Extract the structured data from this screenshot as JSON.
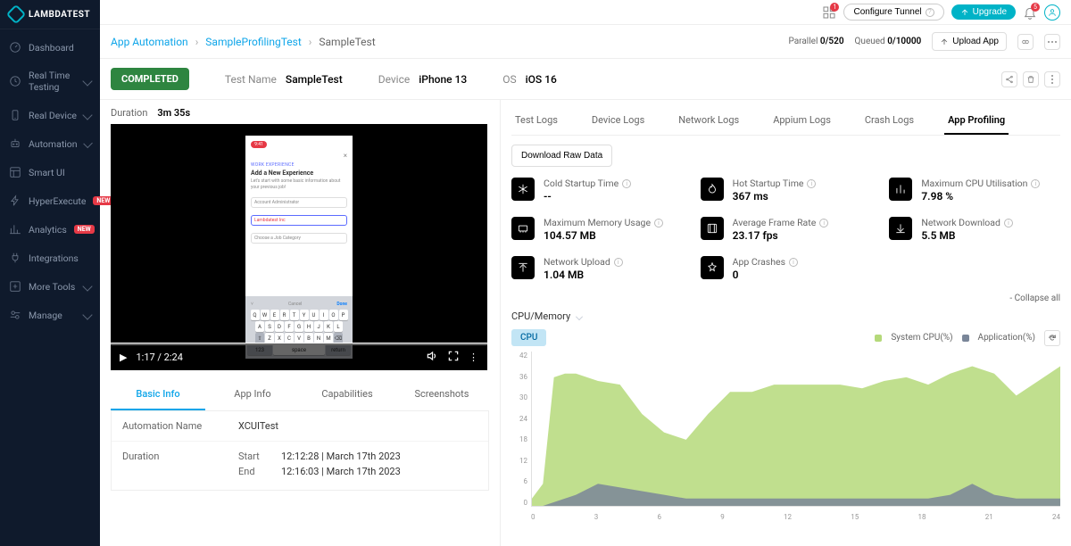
{
  "brand": "LAMBDATEST",
  "sidebar": [
    {
      "label": "Dashboard",
      "icon": "gauge"
    },
    {
      "label": "Real Time Testing",
      "icon": "clock",
      "chev": true
    },
    {
      "label": "Real Device",
      "icon": "device",
      "chev": true
    },
    {
      "label": "Automation",
      "icon": "robot",
      "chev": true
    },
    {
      "label": "Smart UI",
      "icon": "layout"
    },
    {
      "label": "HyperExecute",
      "icon": "bolt",
      "badge": "NEW"
    },
    {
      "label": "Analytics",
      "icon": "chart",
      "badge": "NEW"
    },
    {
      "label": "Integrations",
      "icon": "plug"
    },
    {
      "label": "More Tools",
      "icon": "plus",
      "chev": true
    },
    {
      "label": "Manage",
      "icon": "cog",
      "chev": true
    }
  ],
  "top": {
    "configure": "Configure Tunnel",
    "upgrade": "Upgrade",
    "notif_count": "5",
    "grid_count": "1"
  },
  "breadcrumbs": {
    "a": "App Automation",
    "b": "SampleProfilingTest",
    "c": "SampleTest"
  },
  "stats": {
    "parallel_label": "Parallel",
    "parallel_val": "0/520",
    "queued_label": "Queued",
    "queued_val": "0/10000",
    "upload": "Upload App"
  },
  "summary": {
    "status": "COMPLETED",
    "test_name_label": "Test Name",
    "test_name": "SampleTest",
    "device_label": "Device",
    "device": "iPhone 13",
    "os_label": "OS",
    "os": "iOS 16"
  },
  "duration_label": "Duration",
  "duration": "3m 35s",
  "video": {
    "time": "1:17 / 2:24",
    "screen": {
      "pill": "9:41",
      "section": "WORK EXPERIENCE",
      "title": "Add a New Experience",
      "sub": "Let's start with some basic information about your previous job!",
      "f1": "Account Administrator",
      "f2": "Lambdatest Inc",
      "f3": "Choose a Job Category",
      "cancel": "Cancel",
      "done": "Done",
      "row1": [
        "Q",
        "W",
        "E",
        "R",
        "T",
        "Y",
        "U",
        "I",
        "O",
        "P"
      ],
      "row2": [
        "A",
        "S",
        "D",
        "F",
        "G",
        "H",
        "J",
        "K",
        "L"
      ],
      "row3": [
        "Z",
        "X",
        "C",
        "V",
        "B",
        "N",
        "M"
      ],
      "btn123": "123",
      "btnSpace": "space",
      "btnReturn": "return"
    }
  },
  "info_tabs": [
    "Basic Info",
    "App Info",
    "Capabilities",
    "Screenshots"
  ],
  "basic_info": {
    "automation_name_label": "Automation Name",
    "automation_name": "XCUITest",
    "duration_label": "Duration",
    "start_label": "Start",
    "start": "12:12:28 | March 17th 2023",
    "end_label": "End",
    "end": "12:16:03 | March 17th 2023"
  },
  "right_tabs": [
    "Test Logs",
    "Device Logs",
    "Network Logs",
    "Appium Logs",
    "Crash Logs",
    "App Profiling"
  ],
  "download_btn": "Download Raw Data",
  "metrics": [
    {
      "label": "Cold Startup Time",
      "value": "--",
      "icon": "snow"
    },
    {
      "label": "Hot Startup Time",
      "value": "367 ms",
      "icon": "fire"
    },
    {
      "label": "Maximum CPU Utilisation",
      "value": "7.98 %",
      "icon": "bars"
    },
    {
      "label": "Maximum Memory Usage",
      "value": "104.57 MB",
      "icon": "ram"
    },
    {
      "label": "Average Frame Rate",
      "value": "23.17 fps",
      "icon": "frame"
    },
    {
      "label": "Network Download",
      "value": "5.5 MB",
      "icon": "down"
    },
    {
      "label": "Network Upload",
      "value": "1.04 MB",
      "icon": "up"
    },
    {
      "label": "App Crashes",
      "value": "0",
      "icon": "crash"
    }
  ],
  "collapse": "- Collapse all",
  "chart_dropdown": "CPU/Memory",
  "chart_pill": "CPU",
  "legend_sys": "System CPU(%)",
  "legend_app": "Application(%)",
  "chart_data": {
    "type": "area",
    "xlabel": "",
    "ylabel": "",
    "ylim": [
      0,
      42
    ],
    "x": [
      0,
      3,
      6,
      9,
      12,
      15,
      18,
      21,
      24
    ],
    "y_ticks": [
      0,
      6,
      12,
      18,
      24,
      30,
      36,
      42
    ],
    "x_fine": [
      0,
      0.5,
      1,
      1.5,
      2,
      3,
      4,
      5,
      6,
      7,
      8,
      9,
      10,
      11,
      12,
      13,
      14,
      15,
      16,
      17,
      18,
      19,
      20,
      21,
      22,
      23,
      24
    ],
    "series": [
      {
        "name": "System CPU(%)",
        "color": "#b5d97a",
        "values": [
          2,
          6,
          35,
          36,
          36,
          34,
          33,
          25,
          20,
          18,
          25,
          31,
          31,
          33,
          33,
          33,
          33,
          32,
          34,
          35,
          33,
          36,
          38,
          36,
          30,
          34,
          38
        ]
      },
      {
        "name": "Application(%)",
        "color": "#7a8699",
        "values": [
          0,
          0,
          1,
          2,
          3,
          6,
          5,
          4,
          3,
          2,
          2,
          2,
          2,
          2,
          2,
          2,
          2,
          2,
          2,
          2,
          2,
          3,
          6,
          3,
          2,
          2,
          2
        ]
      }
    ]
  }
}
